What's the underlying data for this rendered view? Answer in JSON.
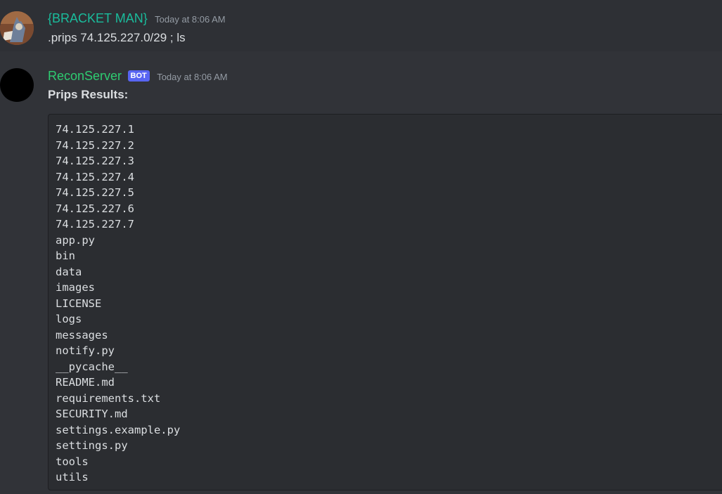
{
  "messages": [
    {
      "username": "{BRACKET MAN}",
      "username_color": "#1abc9c",
      "timestamp": "Today at 8:06 AM",
      "content": ".prips 74.125.227.0/29 ; ls"
    },
    {
      "username": "ReconServer",
      "username_color": "#2ecc71",
      "badge": "BOT",
      "timestamp": "Today at 8:06 AM",
      "content": "Prips Results:",
      "code_lines": [
        "74.125.227.1",
        "74.125.227.2",
        "74.125.227.3",
        "74.125.227.4",
        "74.125.227.5",
        "74.125.227.6",
        "74.125.227.7",
        "app.py",
        "bin",
        "data",
        "images",
        "LICENSE",
        "logs",
        "messages",
        "notify.py",
        "__pycache__",
        "README.md",
        "requirements.txt",
        "SECURITY.md",
        "settings.example.py",
        "settings.py",
        "tools",
        "utils"
      ]
    }
  ]
}
